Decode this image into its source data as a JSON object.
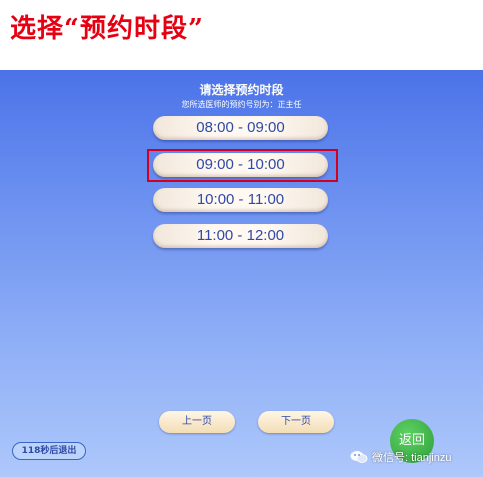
{
  "caption": "选择“预约时段”",
  "screen": {
    "title": "请选择预约时段",
    "subtitle": "您所选医师的预约号别为：正主任",
    "slots": [
      "08:00 - 09:00",
      "09:00 - 10:00",
      "10:00 - 11:00",
      "11:00 - 12:00"
    ],
    "prev_label": "上一页",
    "next_label": "下一页",
    "timer_text": "118秒后退出",
    "back_label": "返回"
  },
  "watermark": {
    "text": "微信号: tianjinzu",
    "icon": "wechat-icon"
  },
  "colors": {
    "caption": "#e60012",
    "highlight": "#d1001f",
    "slot_text": "#2f4aa6",
    "back_button": "#3aa845"
  }
}
